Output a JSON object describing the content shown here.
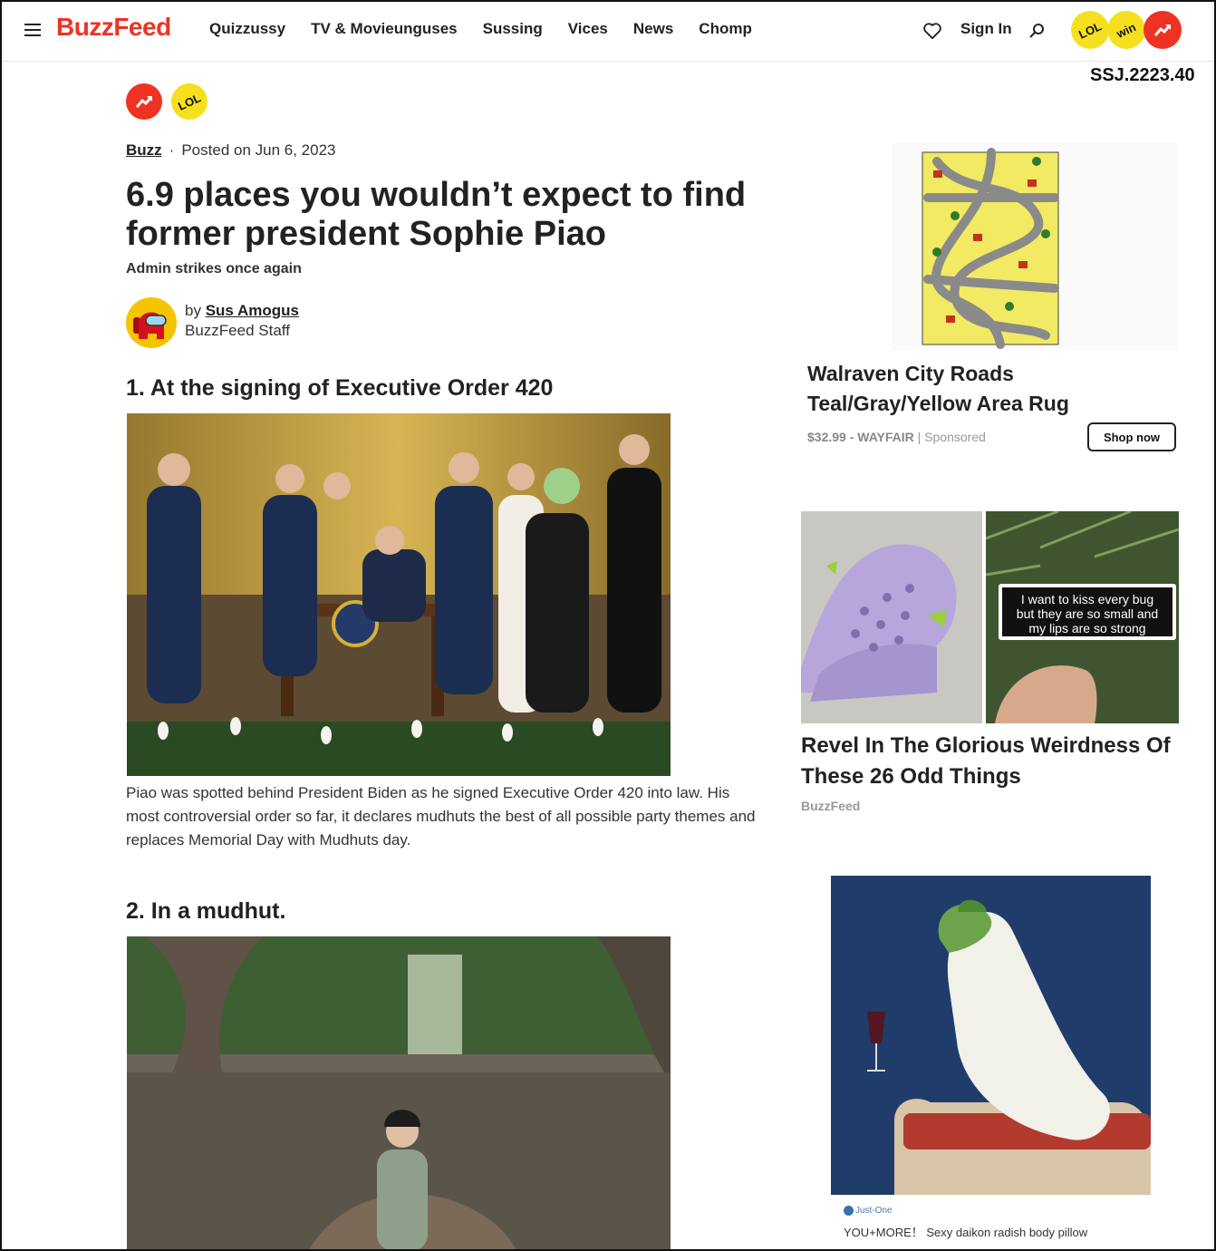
{
  "header": {
    "logo": "BuzzFeed",
    "nav": [
      "Quizzussy",
      "TV & Movieunguses",
      "Sussing",
      "Vices",
      "News",
      "Chomp"
    ],
    "sign_in": "Sign In",
    "badges": [
      "LOL",
      "win"
    ]
  },
  "corner_code": "SSJ.2223.40",
  "article": {
    "post_badges": [
      "LOL"
    ],
    "category": "Buzz",
    "posted": "Posted on Jun 6, 2023",
    "title": "6.9 places you wouldn’t expect to find former president Sophie Piao",
    "dek": "Admin strikes once again",
    "author": {
      "by": "by",
      "name": "Sus Amogus",
      "role": "BuzzFeed Staff"
    },
    "sections": [
      {
        "title": "1. At the signing of Executive Order 420",
        "caption": "Piao was spotted behind President Biden as he signed Executive Order 420 into law. His most controversial order so far, it declares mudhuts the best of all possible party themes and replaces Memorial Day with Mudhuts day."
      },
      {
        "title": "2. In a mudhut."
      }
    ]
  },
  "sidebar": {
    "ad1": {
      "title": "Walraven City Roads Teal/Gray/Yellow Area Rug",
      "price": "$32.99 - WAYFAIR",
      "sponsored": "Sponsored",
      "cta": "Shop now"
    },
    "ad2": {
      "image_text": [
        "I want to kiss every bug",
        "but they are so small and",
        "my lips are so strong"
      ],
      "title": "Revel In The Glorious Weirdness Of These 26 Odd Things",
      "source": "BuzzFeed"
    },
    "ad3": {
      "brand": "Just-One",
      "text": "YOU+MORE！ Sexy daikon radish body pillow"
    }
  },
  "colors": {
    "brand_red": "#ee3322",
    "badge_yellow": "#f5e020"
  }
}
